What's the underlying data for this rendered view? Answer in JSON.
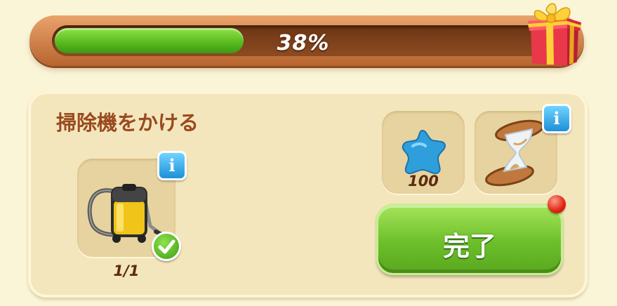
{
  "progress": {
    "percent_label": "38%",
    "fraction": 0.38
  },
  "task": {
    "title": "掃除機をかける",
    "item": {
      "icon": "vacuum-cleaner-icon",
      "count_label": "1/1",
      "completed": true
    }
  },
  "rewards": [
    {
      "icon": "blue-star-icon",
      "amount_label": "100"
    },
    {
      "icon": "hourglass-icon"
    }
  ],
  "actions": {
    "complete_label": "完了"
  },
  "colors": {
    "progress_fill": "#57b91d",
    "progress_frame": "#b8642f",
    "panel_bg": "#f3e6bd",
    "title_text": "#9a4a1f",
    "button_green": "#6cbf2a",
    "info_blue": "#1e8fd8",
    "notify_red": "#e02510"
  }
}
